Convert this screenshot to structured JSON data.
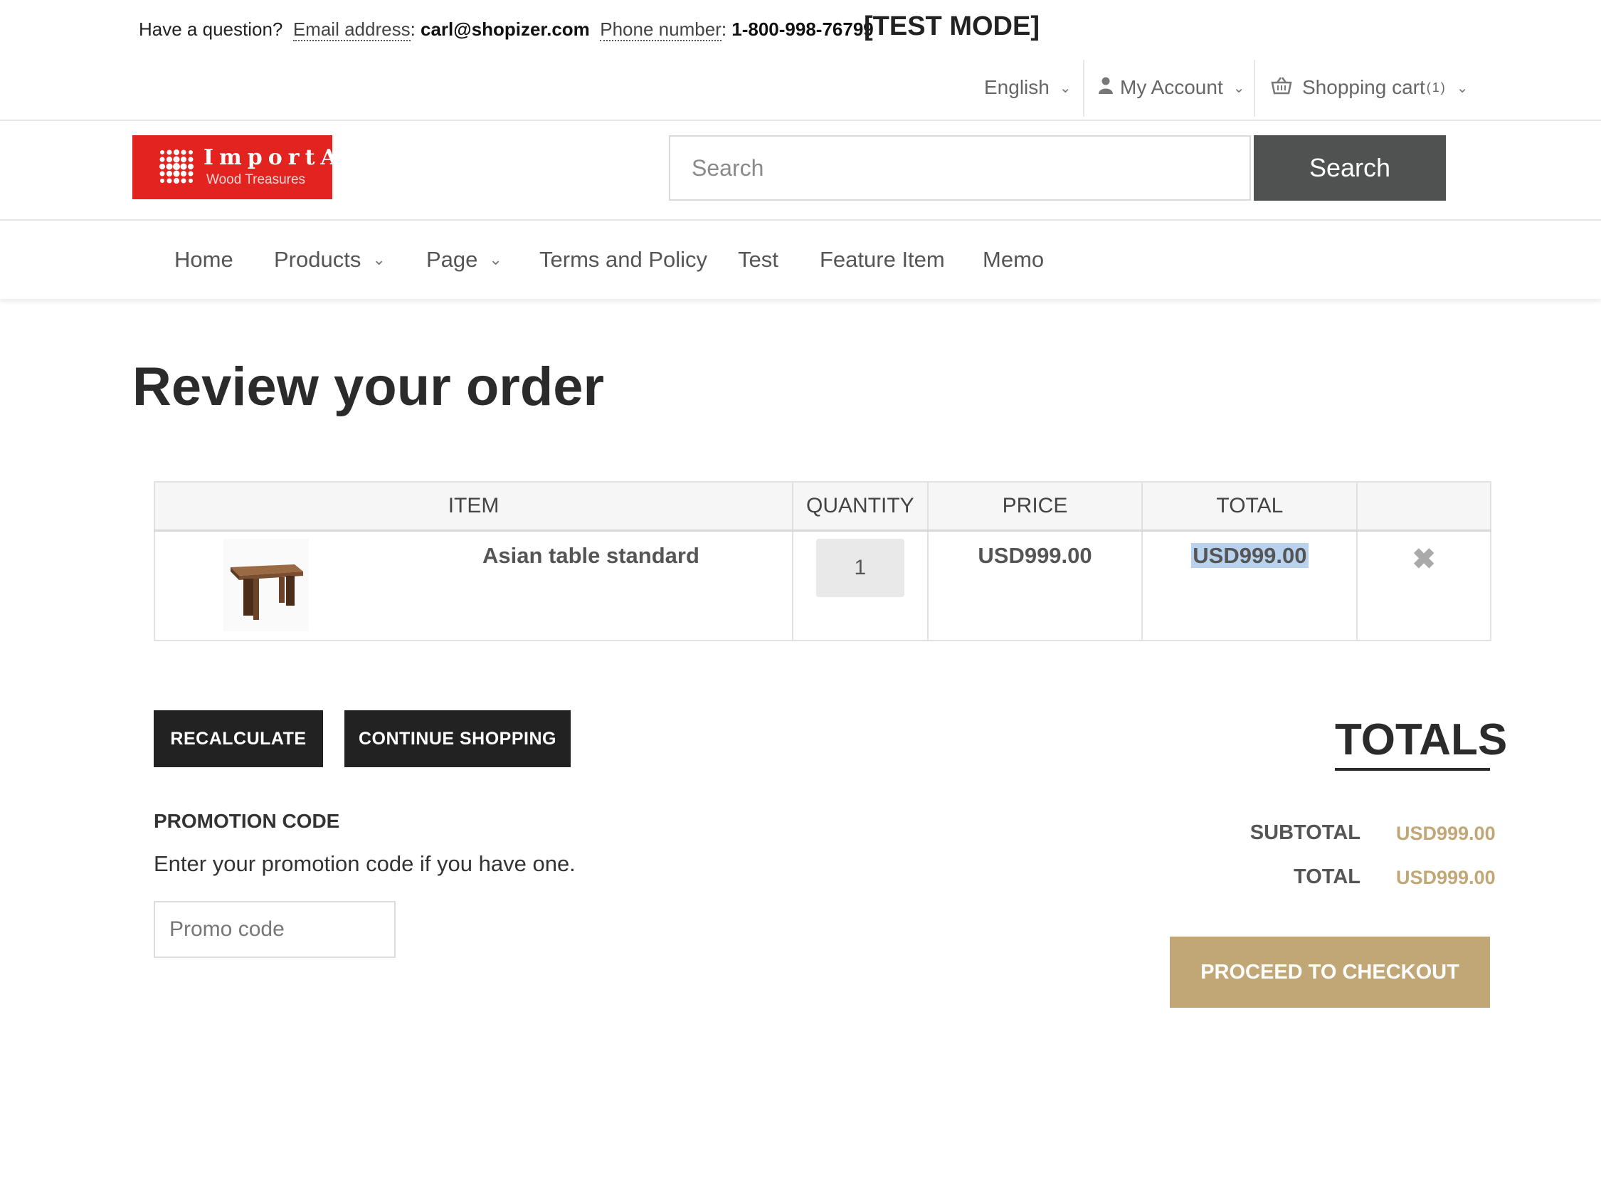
{
  "contact": {
    "question": "Have a question?",
    "email_label": "Email address",
    "email": "carl@shopizer.com",
    "phone_label": "Phone number",
    "phone": "1-800-998-76799",
    "mode": "[TEST MODE]"
  },
  "util": {
    "language": "English",
    "account": "My Account",
    "cart": "Shopping cart",
    "cart_count": "(1)",
    "icons": {
      "account": "user-icon",
      "cart": "basket-icon",
      "dropdown": "chevron-down-icon"
    }
  },
  "logo": {
    "brand": "ImportA",
    "tagline": "Wood Treasures",
    "color": "#e2231f"
  },
  "search": {
    "placeholder": "Search",
    "button": "Search"
  },
  "nav": {
    "home": "Home",
    "products": "Products",
    "page": "Page",
    "terms": "Terms and Policy",
    "test": "Test",
    "feature": "Feature Item",
    "memo": "Memo"
  },
  "page_title": "Review your order",
  "cart": {
    "headers": {
      "item": "ITEM",
      "quantity": "QUANTITY",
      "price": "PRICE",
      "total": "TOTAL"
    },
    "rows": [
      {
        "name": "Asian table standard",
        "quantity": "1",
        "price": "USD999.00",
        "total": "USD999.00",
        "remove_icon": "close-icon"
      }
    ]
  },
  "actions": {
    "recalculate": "RECALCULATE",
    "continue": "CONTINUE SHOPPING"
  },
  "promo": {
    "heading": "PROMOTION CODE",
    "text": "Enter your promotion code if you have one.",
    "placeholder": "Promo code"
  },
  "totals": {
    "heading": "TOTALS",
    "subtotal_label": "SUBTOTAL",
    "subtotal": "USD999.00",
    "total_label": "TOTAL",
    "total": "USD999.00",
    "checkout": "PROCEED TO CHECKOUT",
    "accent": "#c2a776"
  }
}
